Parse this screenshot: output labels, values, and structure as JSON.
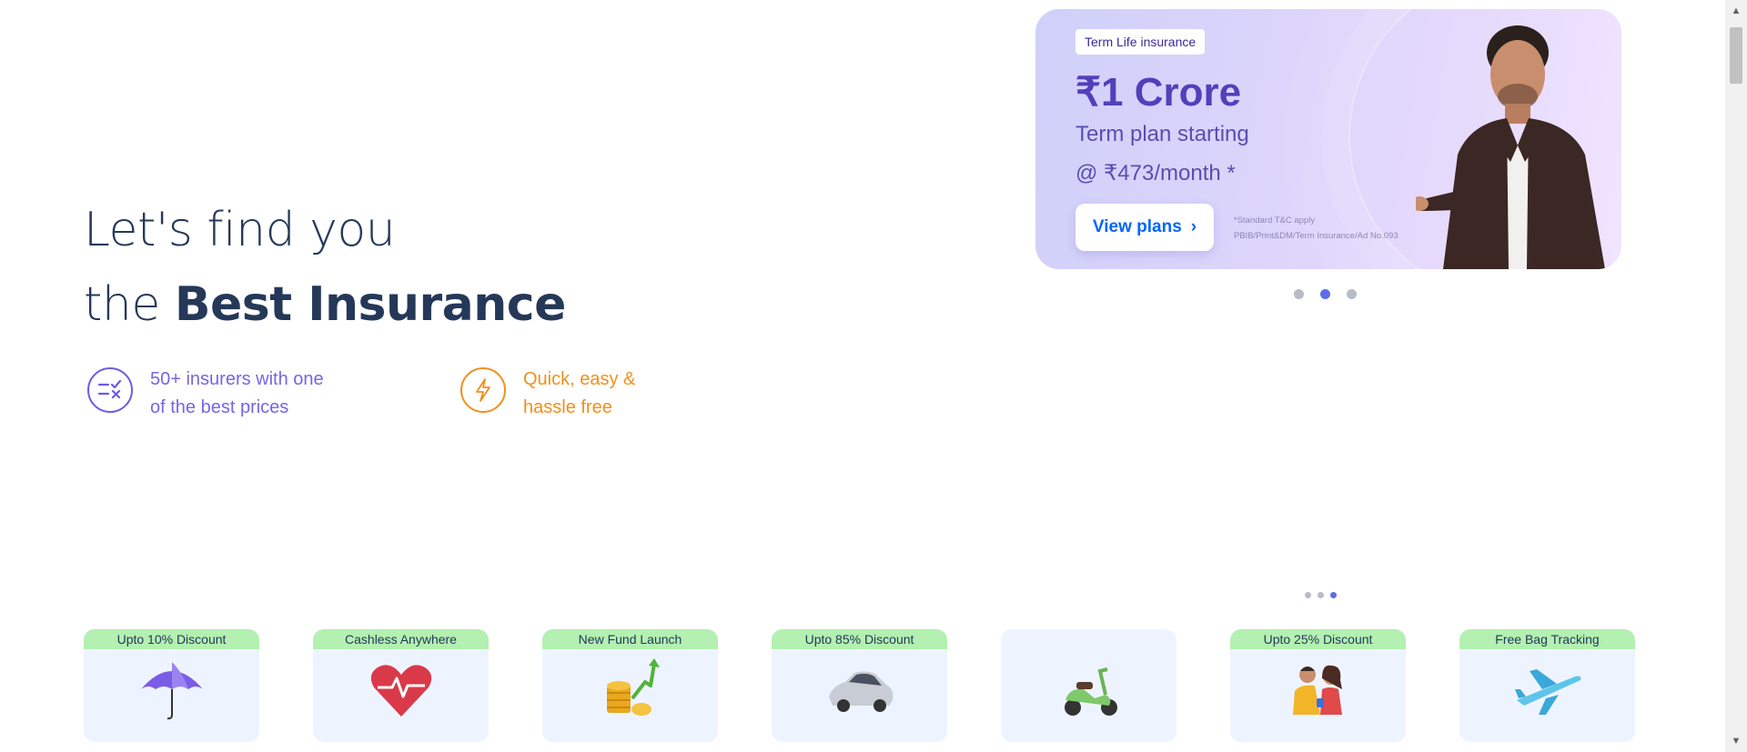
{
  "hero": {
    "line1": "Let's find you",
    "line2_prefix": "the ",
    "line2_bold": "Best Insurance"
  },
  "features": [
    {
      "icon": "compare-check-icon",
      "line1": "50+ insurers with one",
      "line2": "of the best prices",
      "color": "#7566e5"
    },
    {
      "icon": "lightning-icon",
      "line1": "Quick, easy &",
      "line2": "hassle free",
      "color": "#f0901c"
    }
  ],
  "banner": {
    "tag": "Term Life insurance",
    "price": "₹1 Crore",
    "sub1": "Term plan starting",
    "sub2": "@ ₹473/month *",
    "button_label": "View plans",
    "button_chevron": "›",
    "tc_line1": "*Standard T&C apply",
    "tc_line2": "PBIB/Print&DM/Term Insurance/Ad No.093",
    "gradient_colors": [
      "#cfd0fa",
      "#f0e4ff"
    ]
  },
  "carousel": {
    "slide_count": 3,
    "active_index": 1
  },
  "products_pager": {
    "page_count": 3,
    "active_index": 2
  },
  "products": [
    {
      "badge": "Upto 10% Discount",
      "icon": "umbrella-icon"
    },
    {
      "badge": "Cashless Anywhere",
      "icon": "heart-pulse-icon"
    },
    {
      "badge": "New Fund Launch",
      "icon": "coins-growth-icon"
    },
    {
      "badge": "Upto 85% Discount",
      "icon": "car-icon"
    },
    {
      "badge": "",
      "icon": "scooter-icon"
    },
    {
      "badge": "Upto 25% Discount",
      "icon": "family-icon"
    },
    {
      "badge": "Free Bag Tracking",
      "icon": "airplane-icon"
    }
  ],
  "colors": {
    "primary_text": "#253858",
    "link_blue": "#0065ff",
    "badge_green": "#b3f0b1",
    "card_bg": "#eef4ff"
  }
}
